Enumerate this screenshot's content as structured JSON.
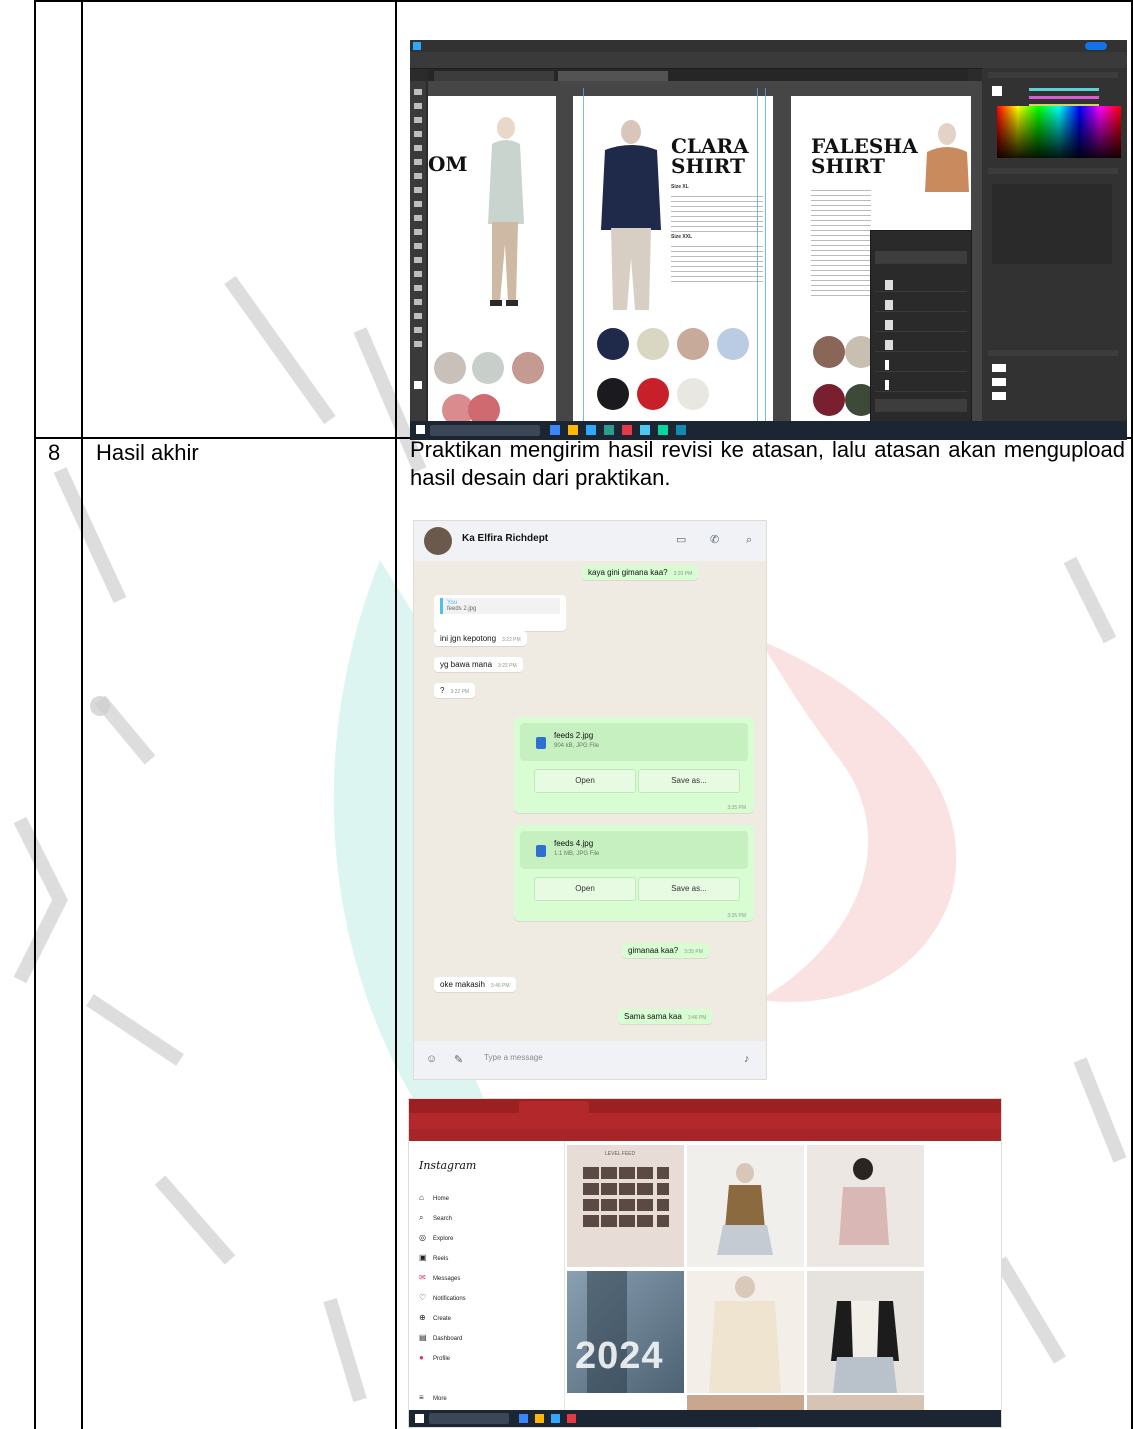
{
  "row": {
    "number": "8",
    "title": "Hasil akhir",
    "description": "Praktikan mengirim hasil revisi ke atasan, lalu atasan akan mengupload hasil desain dari praktikan."
  },
  "photoshop": {
    "pages": [
      {
        "title_line1": "OM",
        "title_line2": ""
      },
      {
        "title_line1": "CLARA",
        "title_line2": "SHIRT"
      },
      {
        "title_line1": "FALESHA",
        "title_line2": "SHIRT"
      }
    ],
    "size_headers": [
      "Size XL",
      "Size XXL"
    ]
  },
  "whatsapp": {
    "contact_name": "Ka Elfira Richdept",
    "messages": [
      {
        "text": "kaya gini gimana kaa?",
        "time": "3:20 PM",
        "dir": "out"
      },
      {
        "text": "ini jgn kepotong",
        "time": "3:22 PM",
        "dir": "in"
      },
      {
        "text": "yg bawa mana",
        "time": "3:22 PM",
        "dir": "in"
      },
      {
        "text": "?",
        "time": "3:22 PM",
        "dir": "in"
      },
      {
        "text": "gimanaa kaa?",
        "time": "3:35 PM",
        "dir": "out"
      },
      {
        "text": "oke makasih",
        "time": "3:45 PM",
        "dir": "in"
      },
      {
        "text": "Sama sama kaa",
        "time": "3:46 PM",
        "dir": "out"
      }
    ],
    "files": [
      {
        "name": "feeds 2.jpg",
        "size": "904 kB, JPG File",
        "open": "Open",
        "save": "Save as...",
        "time": "3:35 PM"
      },
      {
        "name": "feeds 4.jpg",
        "size": "1.1 MB, JPG File",
        "open": "Open",
        "save": "Save as...",
        "time": "3:35 PM"
      }
    ],
    "reply_quote": {
      "author": "You",
      "file": "feeds 2.jpg"
    },
    "input_placeholder": "Type a message"
  },
  "instagram": {
    "logo": "Instagram",
    "nav": [
      "Home",
      "Search",
      "Explore",
      "Reels",
      "Messages",
      "Notifications",
      "Create",
      "Dashboard",
      "Profile",
      "More"
    ],
    "tile_text": "2024",
    "tile_heading": "LEVEL FEED"
  },
  "colors": {
    "wa_out": "#d9fdd3",
    "wa_in": "#ffffff",
    "ig_chrome": "#b3282b",
    "ps_dark": "#2b2b2b"
  }
}
